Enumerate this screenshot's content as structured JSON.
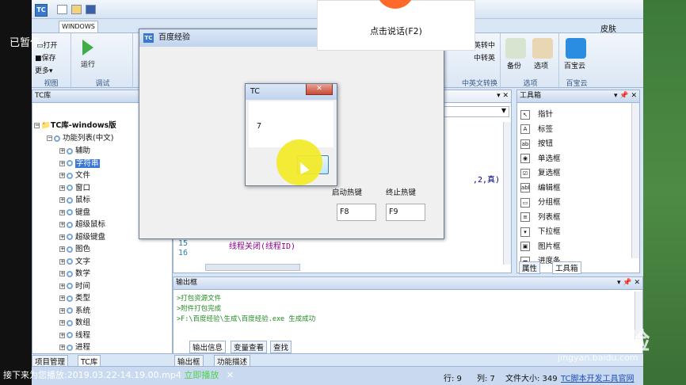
{
  "overlay": {
    "paused_label": "已暂停",
    "voice_prompt": "点击说话(F2)",
    "now_playing": "接下来为您播放:2019.03.22-14.19.00.mp4",
    "play_now": "立即播放",
    "close": "✕",
    "watermark": "Baidu经验",
    "watermark_url": "jingyan.baidu.com"
  },
  "ide": {
    "ribbon_tab": "WINDOWS",
    "skin": "皮肤",
    "groups": {
      "view": {
        "label": "视图",
        "open": "打开",
        "save": "保存",
        "more": "更多"
      },
      "debug": {
        "label": "调试",
        "run": "运行"
      },
      "convert": {
        "label": "中英文转换",
        "a": "英转中",
        "b": "中转英"
      },
      "options": {
        "label": "选项",
        "backup": "备份",
        "options": "选项"
      },
      "cloud": {
        "label": "百宝云",
        "title": "百宝云"
      }
    },
    "tc_panel": {
      "title": "TC库",
      "root": "TC库-windows版",
      "list": "功能列表(中文)",
      "items": [
        "辅助",
        "字符串",
        "文件",
        "窗口",
        "鼠标",
        "键盘",
        "超级鼠标",
        "超级键盘",
        "图色",
        "文字",
        "数学",
        "时间",
        "类型",
        "系统",
        "数组",
        "线程",
        "进程"
      ]
    },
    "editor": {
      "code_partial": ",2,真)",
      "lines": [
        "15",
        "16"
      ],
      "code_line": "线程关闭(线程ID)"
    },
    "toolbox": {
      "title": "工具箱",
      "items": [
        "指针",
        "标签",
        "按钮",
        "单选框",
        "复选框",
        "编辑框",
        "分组框",
        "列表框",
        "下拉框",
        "图片框",
        "进度条"
      ],
      "tabs": [
        "属性",
        "工具箱"
      ]
    },
    "output": {
      "title": "输出框",
      "lines": [
        ">打包资源文件",
        ">附件打包完成",
        ">F:\\百度经验\\生成\\百度经验.exe 生成成功"
      ],
      "tabs": [
        "输出信息",
        "变量查看",
        "查找"
      ]
    },
    "bottom_tabs": [
      "项目管理",
      "TC库",
      "输出框",
      "功能描述"
    ],
    "status": {
      "row": "行: 9",
      "col": "列: 7",
      "filesize": "文件大小: 349",
      "link": "TC脚本开发工具官网"
    }
  },
  "dialog": {
    "title": "百度经验",
    "start_label": "启动热键",
    "stop_label": "终止热键",
    "start_value": "F8",
    "stop_value": "F9"
  },
  "msgbox": {
    "title": "TC",
    "text": "7",
    "close": "✕"
  }
}
